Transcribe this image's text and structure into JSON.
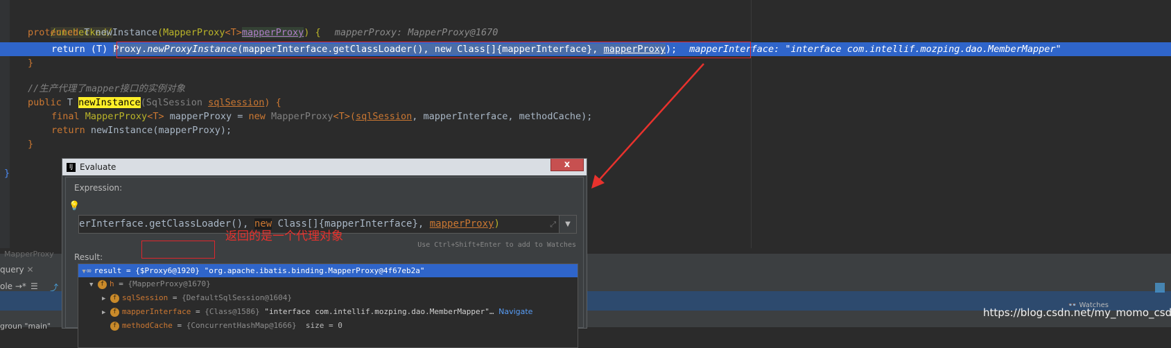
{
  "editor": {
    "line1": "/unchecked/",
    "line2_kw": "protected",
    "line2_t": " T ",
    "line2_method": "newInstance",
    "line2_p1": "(",
    "line2_type": "MapperProxy",
    "line2_gen": "<T>",
    "line2_param": "mapperProxy",
    "line2_p2": ") {",
    "line2_hint": "mapperProxy: MapperProxy@1670",
    "line3_return": "return",
    "line3_cast": " (T) ",
    "line3_call": "Proxy.",
    "line3_method": "newProxyInstance",
    "line3_args": "(mapperInterface.getClassLoader(), new Class[]{mapperInterface}, ",
    "line3_arg_last": "mapperProxy",
    "line3_end": ");",
    "line3_hint": "mapperInterface: \"interface com.intellif.mozping.dao.MemberMapper\"",
    "line4": "}",
    "line5_comment": "//生产代理了mapper接口的实例对象",
    "line6_kw": "public",
    "line6_t": " T ",
    "line6_method": "newInstance",
    "line6_p1": "(SqlSession ",
    "line6_param": "sqlSession",
    "line6_p2": ") {",
    "line7_kw": "final",
    "line7_type": " MapperProxy",
    "line7_gen": "<T>",
    "line7_var": " mapperProxy = ",
    "line7_new": "new",
    "line7_ctor": " MapperProxy",
    "line7_gen2": "<T>",
    "line7_p1": "(",
    "line7_arg1": "sqlSession",
    "line7_rest": ", mapperInterface, methodCache);",
    "line8_kw": "return",
    "line8_rest": " newInstance(mapperProxy);",
    "line9": "}",
    "line10": "}"
  },
  "bottom": {
    "tab_label": "MapperProxy",
    "panel_label": "query",
    "console_label": "ole →*",
    "thread_label": "groun \"main\"",
    "watches_label": "Watches"
  },
  "dialog": {
    "title": "Evaluate",
    "close": "x",
    "expression_label": "Expression:",
    "expression_pre": "erInterface.getClassLoader(), ",
    "expression_new": "new",
    "expression_mid": " Class[]{mapperInterface}, ",
    "expression_last": "mapperProxy",
    "expression_end": ")",
    "hint": "Use Ctrl+Shift+Enter to add to Watches",
    "result_label": "Result:",
    "rows": [
      {
        "name": "result",
        "eq": " = ",
        "ref": "{$Proxy6@1920}",
        "val": " \"org.apache.ibatis.binding.MapperProxy@4f67eb2a\""
      },
      {
        "name": "h",
        "eq": " = ",
        "ref": "{MapperProxy@1670}",
        "val": ""
      },
      {
        "name": "sqlSession",
        "eq": " = ",
        "ref": "{DefaultSqlSession@1604}",
        "val": ""
      },
      {
        "name": "mapperInterface",
        "eq": " = ",
        "ref": "{Class@1586}",
        "val": " \"interface com.intellif.mozping.dao.MemberMapper\"…",
        "link": "Navigate"
      },
      {
        "name": "methodCache",
        "eq": " = ",
        "ref": "{ConcurrentHashMap@1666}",
        "val": "  size = 0"
      }
    ]
  },
  "annotation": "返回的是一个代理对象",
  "watermark": "https://blog.csdn.net/my_momo_csdn",
  "colors": {
    "accent": "#2f65ca",
    "annotation_red": "#e8322d"
  }
}
